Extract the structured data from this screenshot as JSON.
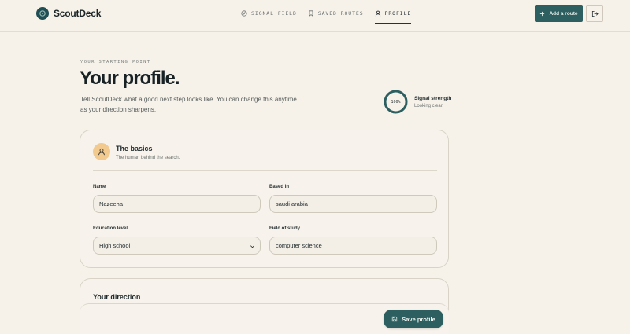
{
  "brand": {
    "name": "ScoutDeck"
  },
  "nav": [
    {
      "label": "SIGNAL FIELD",
      "icon": "compass-icon"
    },
    {
      "label": "SAVED ROUTES",
      "icon": "bookmark-icon"
    },
    {
      "label": "PROFILE",
      "icon": "user-icon",
      "active": true
    }
  ],
  "actions": {
    "add_route": "Add a route"
  },
  "header": {
    "eyebrow": "YOUR STARTING POINT",
    "title": "Your profile.",
    "intro": "Tell ScoutDeck what a good next step looks like. You can change this anytime as your direction sharpens."
  },
  "signal": {
    "percent_text": "100%",
    "value": 1.0,
    "title": "Signal strength",
    "status": "Looking clear."
  },
  "basics": {
    "title": "The basics",
    "subtitle": "The human behind the search.",
    "fields": {
      "name": {
        "label": "Name",
        "value": "Nazeeha"
      },
      "based_in": {
        "label": "Based in",
        "value": "saudi arabia"
      },
      "education": {
        "label": "Education level",
        "value": "High school"
      },
      "field_of_study": {
        "label": "Field of study",
        "value": "computer science"
      }
    }
  },
  "direction": {
    "title": "Your direction"
  },
  "save": {
    "label": "Save profile"
  },
  "colors": {
    "accent": "#2d5f60",
    "background": "#f6f2ea",
    "avatar": "#f2c98e"
  }
}
